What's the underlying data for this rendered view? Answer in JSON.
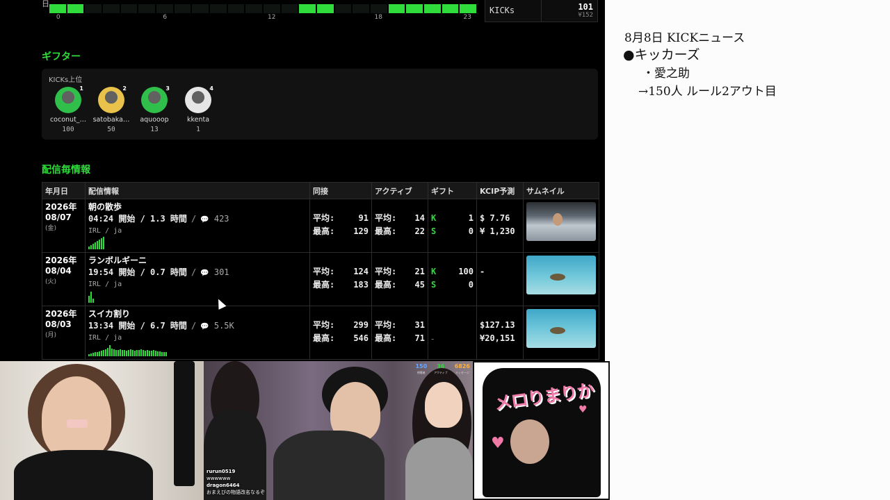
{
  "hourly": {
    "day_label": "日",
    "hour_ticks": [
      "0",
      "6",
      "12",
      "18",
      "23"
    ],
    "active_hours": [
      0,
      1,
      14,
      15,
      19,
      20,
      21,
      22,
      23
    ]
  },
  "kicks_summary": {
    "label": "KICKs",
    "value": "101",
    "yen": "¥152"
  },
  "gifters": {
    "title": "ギフター",
    "subtitle": "KICKs上位",
    "items": [
      {
        "rank": "1",
        "name": "coconut_…",
        "value": "100",
        "avatar_color": "#2fbf4a"
      },
      {
        "rank": "2",
        "name": "satobaka…",
        "value": "50",
        "avatar_color": "#e8c24a"
      },
      {
        "rank": "3",
        "name": "aquooop",
        "value": "13",
        "avatar_color": "#2fbf4a"
      },
      {
        "rank": "4",
        "name": "kkenta",
        "value": "1",
        "avatar_color": "#e6e6e6"
      }
    ]
  },
  "streams": {
    "title": "配信毎情報",
    "headers": [
      "年月日",
      "配信情報",
      "同接",
      "アクティブ",
      "ギフト",
      "KCIP予測",
      "サムネイル"
    ],
    "rows": [
      {
        "year": "2026年",
        "date": "08/07",
        "weekday": "(金)",
        "title": "朝の散歩",
        "start": "04:24 開始",
        "duration": "1.3 時間",
        "comments": "423",
        "category": "IRL / ja",
        "viewers_avg": "91",
        "viewers_max": "129",
        "active_avg": "14",
        "active_max": "22",
        "gift_k": "1",
        "gift_s": "0",
        "kcip_usd": "$  7.76",
        "kcip_yen": "¥ 1,230",
        "spark": [
          4,
          6,
          8,
          10,
          12,
          14,
          16,
          18
        ],
        "thumb": "car"
      },
      {
        "year": "2026年",
        "date": "08/04",
        "weekday": "(火)",
        "title": "ランボルギーニ",
        "start": "19:54 開始",
        "duration": "0.7 時間",
        "comments": "301",
        "category": "IRL / ja",
        "viewers_avg": "124",
        "viewers_max": "183",
        "active_avg": "21",
        "active_max": "45",
        "gift_k": "100",
        "gift_s": "0",
        "kcip_usd": "-",
        "kcip_yen": "",
        "spark": [
          10,
          16,
          6
        ],
        "thumb": "sea"
      },
      {
        "year": "2026年",
        "date": "08/03",
        "weekday": "(月)",
        "title": "スイカ割り",
        "start": "13:34 開始",
        "duration": "6.7 時間",
        "comments": "5.5K",
        "category": "IRL / ja",
        "viewers_avg": "299",
        "viewers_max": "546",
        "active_avg": "31",
        "active_max": "71",
        "gift_k": "",
        "gift_s": "",
        "kcip_usd": "$127.13",
        "kcip_yen": "¥20,151",
        "spark": [
          3,
          4,
          5,
          6,
          6,
          7,
          8,
          9,
          10,
          12,
          16,
          11,
          10,
          9,
          9,
          10,
          9,
          9,
          8,
          9,
          10,
          9,
          8,
          9,
          9,
          10,
          9,
          8,
          9,
          8,
          8,
          9,
          8,
          7,
          7,
          6,
          6,
          6
        ],
        "thumb": "sea"
      }
    ],
    "labels": {
      "avg": "平均:",
      "max": "最高:",
      "k_badge": "K",
      "s_badge": "S",
      "dash": "-"
    }
  },
  "notes": {
    "lines": [
      "8月8日 KICKニュース",
      "●キッカーズ",
      "・愛之助",
      "→150人 ルール2アウト目"
    ]
  },
  "cam2_overlay": {
    "stats": [
      {
        "value": "150",
        "label": "視聴者",
        "color": "#6aa9ff"
      },
      {
        "value": "36",
        "label": "アクティブ",
        "color": "#2fdc3c"
      },
      {
        "value": "6826",
        "label": "メッセージ",
        "color": "#ffb03a"
      }
    ],
    "chat": [
      {
        "user": "rurun0519",
        "text": ""
      },
      {
        "user": "",
        "text": "wwwwww"
      },
      {
        "user": "dragon6464",
        "text": ""
      },
      {
        "user": "",
        "text": "おまえびの物語改名なるぞ"
      }
    ]
  },
  "cam3": {
    "shirt_text": "メロりまりか",
    "heart_text": "好き"
  }
}
